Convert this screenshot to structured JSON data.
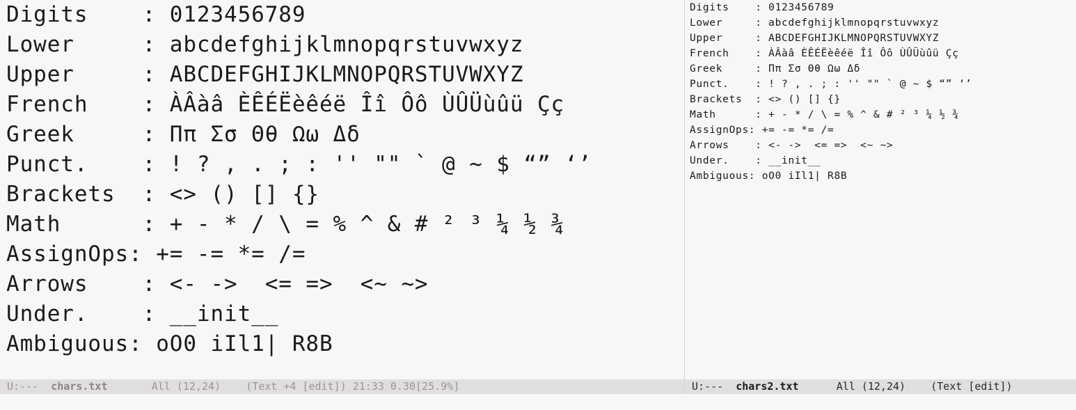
{
  "left_pane": {
    "lines": [
      "Digits    : 0123456789",
      "Lower     : abcdefghijklmnopqrstuvwxyz",
      "Upper     : ABCDEFGHIJKLMNOPQRSTUVWXYZ",
      "French    : ÀÂàâ ÈÊÉËèêéë Îî Ôô ÙÛÜùûü Çç",
      "Greek     : Ππ Σσ Θθ Ωω Δδ",
      "Punct.    : ! ? , . ; : '' \"\" ` @ ~ $ “” ‘’",
      "Brackets  : <> () [] {}",
      "Math      : + - * / \\ = % ^ & # ² ³ ¼ ½ ¾",
      "AssignOps: += -= *= /=",
      "Arrows    : <- ->  <= =>  <~ ~>",
      "Under.    : __init__",
      "Ambiguous: oO0 iIl1| R8B"
    ]
  },
  "right_pane": {
    "lines": [
      "Digits    : 0123456789",
      "Lower     : abcdefghijklmnopqrstuvwxyz",
      "Upper     : ABCDEFGHIJKLMNOPQRSTUVWXYZ",
      "French    : ÀÂàâ ÈÊÉËèêéë Îî Ôô ÙÛÜùûü Çç",
      "Greek     : Ππ Σσ Θθ Ωω Δδ",
      "Punct.    : ! ? , . ; : '' \"\" ` @ ~ $ “” ‘’",
      "Brackets  : <> () [] {}",
      "Math      : + - * / \\ = % ^ & # ² ³ ¼ ½ ¾",
      "AssignOps: += -= *= /=",
      "Arrows    : <- ->  <= =>  <~ ~>",
      "Under.    : __init__",
      "Ambiguous: oO0 iIl1| R8B"
    ]
  },
  "modeline_left": {
    "status": "U:---  ",
    "buffer": "chars.txt",
    "position": "       All (12,24)    ",
    "mode": "(Text +4 [edit]) 21:33 0.30[25.9%]"
  },
  "modeline_right": {
    "status": "U:---  ",
    "buffer": "chars2.txt",
    "position": "      All (12,24)    ",
    "mode": "(Text [edit])"
  },
  "colors": {
    "background": "#f8f7f7",
    "text": "#1a1a1a",
    "modeline_bg": "#e0dede",
    "modeline_inactive_fg": "#9a9595",
    "divider": "#d4d1d1"
  }
}
